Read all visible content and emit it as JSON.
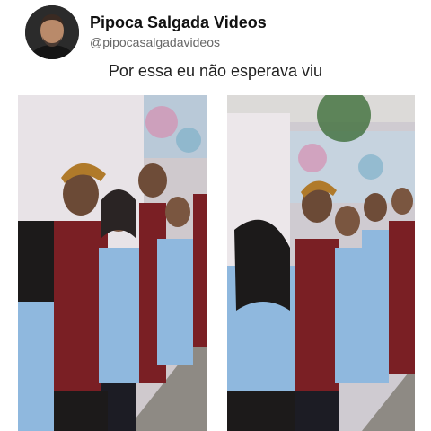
{
  "post": {
    "account_name": "Pipoca Salgada Videos",
    "account_handle": "@pipocasalgadavideos",
    "avatar_icon": "profile-photo-avatar",
    "caption": "Por essa eu não esperava viu"
  },
  "media": {
    "frames": [
      {
        "alt": "video-frame-1",
        "shirt_print": "BLUE"
      },
      {
        "alt": "video-frame-2",
        "shirt_print": "BLUE"
      }
    ]
  },
  "colors": {
    "background": "#ffffff",
    "shirt_blue": "#8fb8de",
    "shirt_red": "#7a1f24",
    "curtain": "#e8e3e7",
    "ground": "#8e8a84"
  }
}
